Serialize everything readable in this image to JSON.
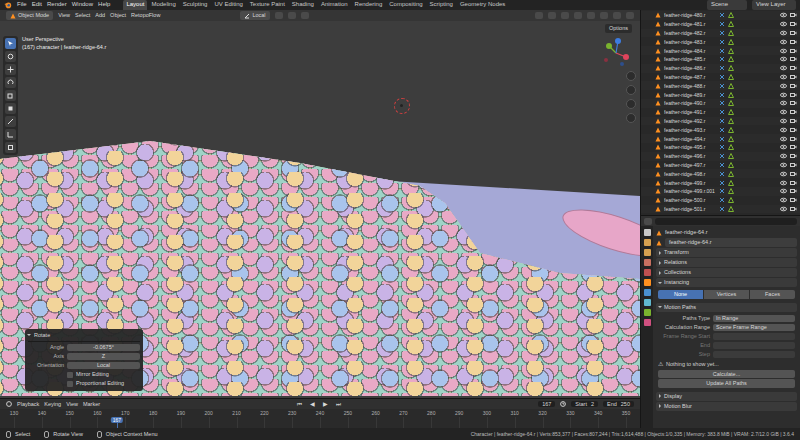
{
  "menubar": {
    "menus": [
      "File",
      "Edit",
      "Render",
      "Window",
      "Help"
    ],
    "workspaces": [
      {
        "label": "Layout",
        "selected": true
      },
      {
        "label": "Modeling",
        "selected": false
      },
      {
        "label": "Sculpting",
        "selected": false
      },
      {
        "label": "UV Editing",
        "selected": false
      },
      {
        "label": "Texture Paint",
        "selected": false
      },
      {
        "label": "Shading",
        "selected": false
      },
      {
        "label": "Animation",
        "selected": false
      },
      {
        "label": "Rendering",
        "selected": false
      },
      {
        "label": "Compositing",
        "selected": false
      },
      {
        "label": "Scripting",
        "selected": false
      },
      {
        "label": "Geometry Nodes",
        "selected": false
      }
    ],
    "scene": "Scene",
    "view_layer": "View Layer"
  },
  "viewport_header": {
    "mode": "Object Mode",
    "menus": [
      "View",
      "Select",
      "Add",
      "Object",
      "RetopoFlow"
    ],
    "orientation": "Local",
    "options": "Options"
  },
  "viewport": {
    "perspective": "User Perspective",
    "context": "(167) character | feather-ridge-64.r"
  },
  "operator_panel": {
    "title": "Rotate",
    "rows": [
      {
        "kind": "field",
        "label": "Angle",
        "value": "-0.0675°"
      },
      {
        "kind": "field",
        "label": "Axis",
        "value": "Z"
      },
      {
        "kind": "field",
        "label": "Orientation",
        "value": "Local"
      },
      {
        "kind": "checkbox",
        "label": "Mirror Editing",
        "checked": false
      },
      {
        "kind": "checkbox",
        "label": "Proportional Editing",
        "checked": false
      }
    ]
  },
  "outliner": {
    "rows": [
      "feather-ridge-480.r",
      "feather-ridge-481.r",
      "feather-ridge-482.r",
      "feather-ridge-483.r",
      "feather-ridge-484.r",
      "feather-ridge-485.r",
      "feather-ridge-486.r",
      "feather-ridge-487.r",
      "feather-ridge-488.r",
      "feather-ridge-489.r",
      "feather-ridge-490.r",
      "feather-ridge-491.r",
      "feather-ridge-492.r",
      "feather-ridge-493.r",
      "feather-ridge-494.r",
      "feather-ridge-495.r",
      "feather-ridge-496.r",
      "feather-ridge-497.r",
      "feather-ridge-498.r",
      "feather-ridge-499.r",
      "feather-ridge-499.r.001",
      "feather-ridge-500.r",
      "feather-ridge-501.r"
    ]
  },
  "properties": {
    "header_object": "feather-ridge-64.r",
    "name_field": "feather-ridge-64.r",
    "sections": [
      {
        "title": "Transform",
        "expanded": false,
        "kind": "plain"
      },
      {
        "title": "Relations",
        "expanded": false,
        "kind": "plain"
      },
      {
        "title": "Collections",
        "expanded": false,
        "kind": "plain"
      },
      {
        "title": "Instancing",
        "expanded": true,
        "kind": "instancing",
        "options": [
          {
            "label": "None",
            "selected": true
          },
          {
            "label": "Vertices",
            "selected": false
          },
          {
            "label": "Faces",
            "selected": false
          }
        ]
      },
      {
        "title": "Motion Paths",
        "expanded": true,
        "kind": "motion_paths",
        "fields": [
          {
            "label": "Paths Type",
            "value": "In Range",
            "disabled": false
          },
          {
            "label": "Calculation Range",
            "value": "Scene Frame Range",
            "disabled": false
          },
          {
            "label": "Frame Range Start",
            "disabled": true
          },
          {
            "label": "End",
            "disabled": true
          },
          {
            "label": "Step",
            "disabled": true
          }
        ],
        "warning_icon": "⚠",
        "warning": "Nothing to show yet...",
        "buttons": [
          "Calculate...",
          "Update All Paths"
        ]
      },
      {
        "title": "Display",
        "expanded": false,
        "kind": "plain"
      },
      {
        "title": "Motion Blur",
        "expanded": false,
        "kind": "plain"
      }
    ]
  },
  "timeline": {
    "menus": [
      "Playback",
      "Keying",
      "View",
      "Marker"
    ],
    "transport": [
      "⏮",
      "◀",
      "▶",
      "⏭"
    ],
    "frame_field": "167",
    "start_label": "Start",
    "start": "2",
    "end_label": "End",
    "end": "250",
    "ticks": [
      "130",
      "140",
      "150",
      "160",
      "170",
      "180",
      "190",
      "200",
      "210",
      "220",
      "230",
      "240",
      "250",
      "260",
      "270",
      "280",
      "290",
      "300",
      "310",
      "320",
      "330",
      "340",
      "350"
    ],
    "current_frame": "167"
  },
  "status_bar": {
    "hints": [
      "Select",
      "Rotate View",
      "Object Context Menu"
    ],
    "stats": "Character | feather-ridge-64.r | Verts:853,377 | Faces:807,244 | Tris:1,614,488 | Objects:1/0,335 | Memory: 383.8 MiB | VRAM: 2.7/12.0 GiB | 3.6.4"
  }
}
